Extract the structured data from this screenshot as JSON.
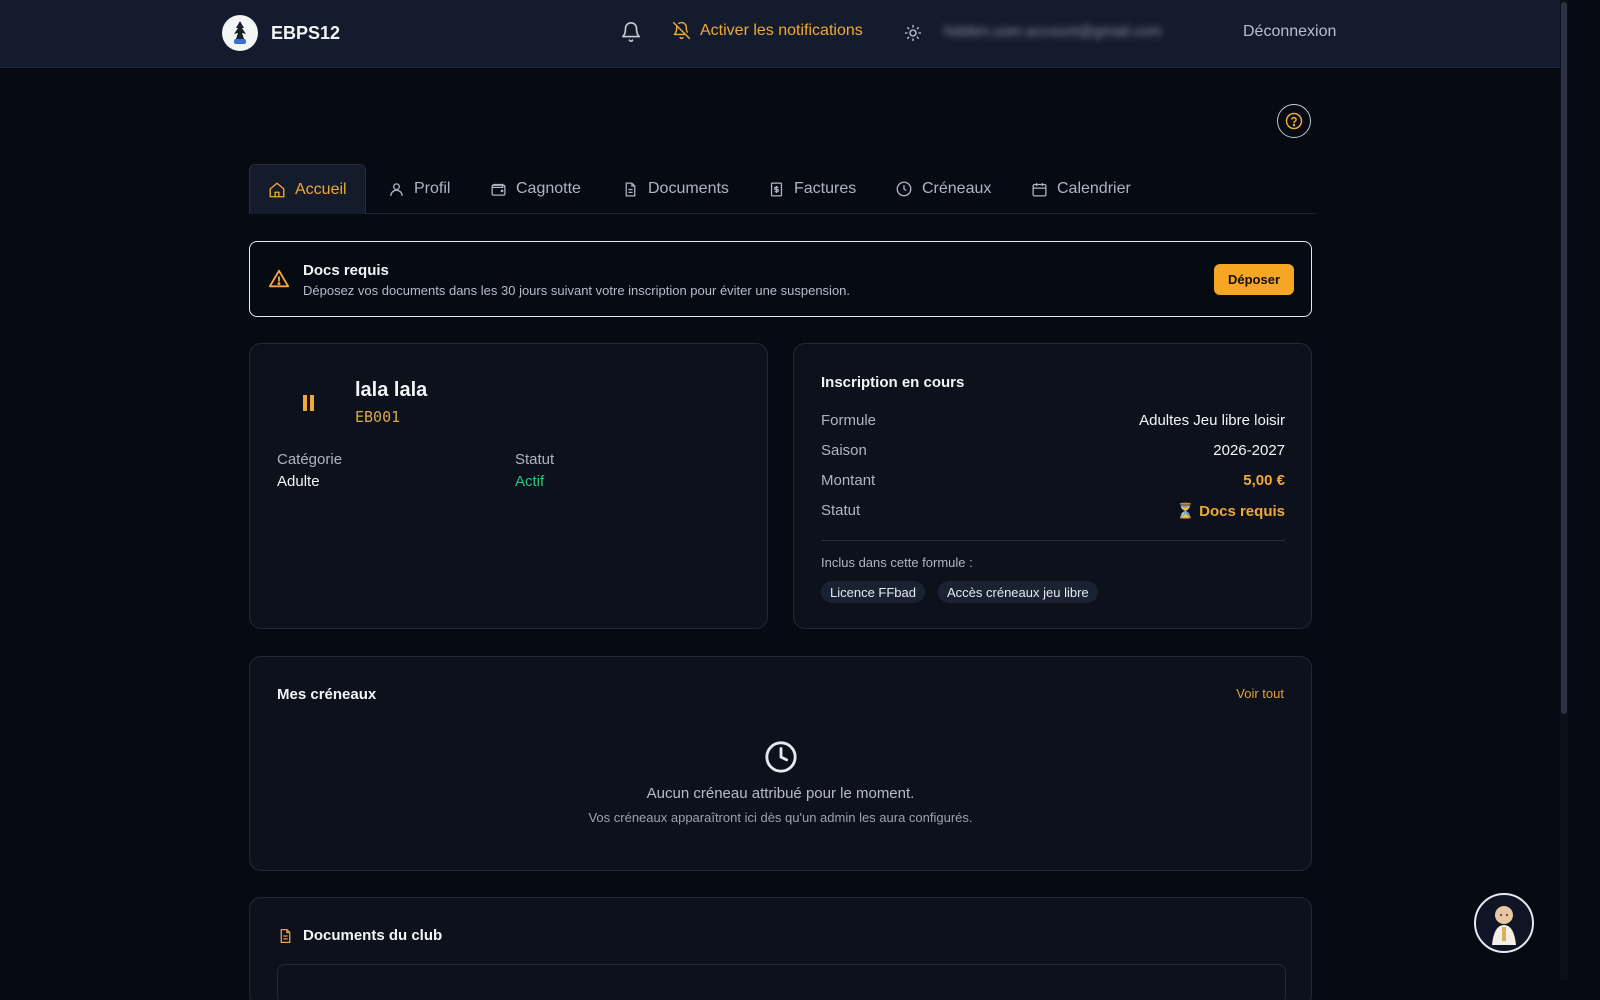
{
  "header": {
    "brand": "EBPS12",
    "notif_label": "Activer les notifications",
    "email": "hidden.user.account@gmail.com",
    "logout": "Déconnexion"
  },
  "tabs": [
    {
      "label": "Accueil",
      "icon": "home-icon",
      "active": true
    },
    {
      "label": "Profil",
      "icon": "user-icon"
    },
    {
      "label": "Cagnotte",
      "icon": "wallet-icon"
    },
    {
      "label": "Documents",
      "icon": "document-icon"
    },
    {
      "label": "Factures",
      "icon": "invoice-icon"
    },
    {
      "label": "Créneaux",
      "icon": "clock-icon"
    },
    {
      "label": "Calendrier",
      "icon": "calendar-icon"
    }
  ],
  "alert": {
    "title": "Docs requis",
    "text": "Déposez vos documents dans les 30 jours suivant votre inscription pour éviter une suspension.",
    "button": "Déposer"
  },
  "member": {
    "name": "lala lala",
    "id": "EB001",
    "category_label": "Catégorie",
    "category": "Adulte",
    "status_label": "Statut",
    "status": "Actif"
  },
  "inscription": {
    "title": "Inscription en cours",
    "rows": [
      {
        "k": "Formule",
        "v": "Adultes Jeu libre loisir"
      },
      {
        "k": "Saison",
        "v": "2026-2027"
      },
      {
        "k": "Montant",
        "v": "5,00 €"
      },
      {
        "k": "Statut",
        "v": "⏳ Docs requis"
      }
    ],
    "included_label": "Inclus dans cette formule :",
    "chips": [
      "Licence FFbad",
      "Accès créneaux jeu libre"
    ]
  },
  "slots": {
    "title": "Mes créneaux",
    "see_all": "Voir tout",
    "empty": "Aucun créneau attribué pour le moment.",
    "empty_sub": "Vos créneaux apparaîtront ici dès qu'un admin les aura configurés."
  },
  "docs": {
    "title": "Documents du club"
  },
  "colors": {
    "accent": "#f0a83a",
    "success": "#2ec27e",
    "background": "#060a13"
  }
}
